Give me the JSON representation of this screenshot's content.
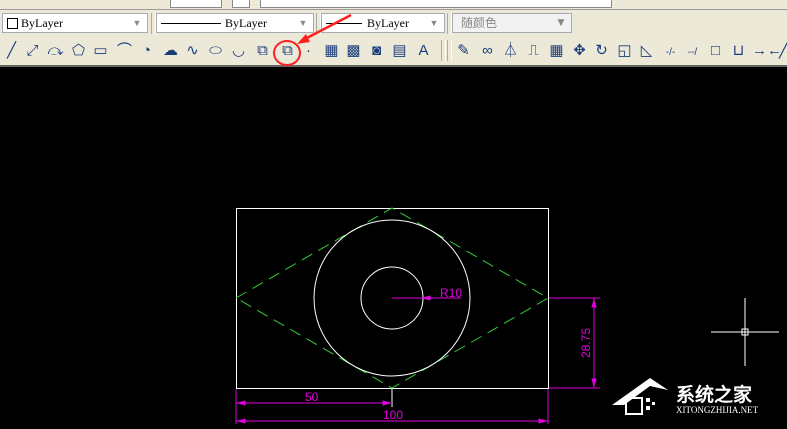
{
  "properties_bar": {
    "color": {
      "value": "ByLayer"
    },
    "linetype": {
      "value": "ByLayer"
    },
    "lineweight": {
      "value": "ByLayer"
    },
    "plot_style": {
      "value": "随颜色",
      "disabled": true
    }
  },
  "draw_toolbar": [
    {
      "name": "line-icon",
      "glyph": "╱"
    },
    {
      "name": "construction-line-icon",
      "glyph": "⤢"
    },
    {
      "name": "polyline-icon",
      "glyph": "⤼"
    },
    {
      "name": "polygon-icon",
      "glyph": "⬠"
    },
    {
      "name": "rectangle-icon",
      "glyph": "▭"
    },
    {
      "name": "arc-icon",
      "glyph": "⌒"
    },
    {
      "name": "circle-icon",
      "glyph": "◔"
    },
    {
      "name": "revision-cloud-icon",
      "glyph": "☁"
    },
    {
      "name": "spline-icon",
      "glyph": "∿"
    },
    {
      "name": "ellipse-icon",
      "glyph": "⬭"
    },
    {
      "name": "ellipse-arc-icon",
      "glyph": "◡"
    },
    {
      "name": "insert-block-icon",
      "glyph": "⧉"
    },
    {
      "name": "make-block-icon",
      "glyph": "⧉",
      "highlighted": true
    },
    {
      "name": "point-icon",
      "glyph": "·"
    },
    {
      "name": "hatch-icon",
      "glyph": "▦"
    },
    {
      "name": "gradient-icon",
      "glyph": "▩"
    },
    {
      "name": "region-icon",
      "glyph": "◙"
    },
    {
      "name": "table-icon",
      "glyph": "▤"
    },
    {
      "name": "multiline-text-icon",
      "glyph": "A"
    }
  ],
  "modify_toolbar": [
    {
      "name": "erase-icon",
      "glyph": "✎"
    },
    {
      "name": "copy-icon",
      "glyph": "∞"
    },
    {
      "name": "mirror-icon",
      "glyph": "⏃"
    },
    {
      "name": "offset-icon",
      "glyph": "⎍"
    },
    {
      "name": "array-icon",
      "glyph": "▦"
    },
    {
      "name": "move-icon",
      "glyph": "✥"
    },
    {
      "name": "rotate-icon",
      "glyph": "↻"
    },
    {
      "name": "scale-icon",
      "glyph": "◱"
    },
    {
      "name": "stretch-icon",
      "glyph": "◺"
    },
    {
      "name": "trim-icon",
      "glyph": "-/-"
    },
    {
      "name": "extend-icon",
      "glyph": "--/"
    },
    {
      "name": "break-at-point-icon",
      "glyph": "□"
    },
    {
      "name": "break-icon",
      "glyph": "⊔"
    },
    {
      "name": "join-icon",
      "glyph": "→←"
    },
    {
      "name": "chamfer-icon",
      "glyph": "╱"
    }
  ],
  "drawing": {
    "dimensions": {
      "radius": "R10",
      "vertical": "28.75",
      "half_width": "50",
      "width": "100"
    },
    "colors": {
      "geometry": "#ffffff",
      "dashed": "#33cc33",
      "dimension": "#e000e0",
      "annotation_arrow": "#ff2020"
    }
  },
  "watermark": {
    "title": "系统之家",
    "subtitle": "XITONGZHIJIA.NET"
  }
}
